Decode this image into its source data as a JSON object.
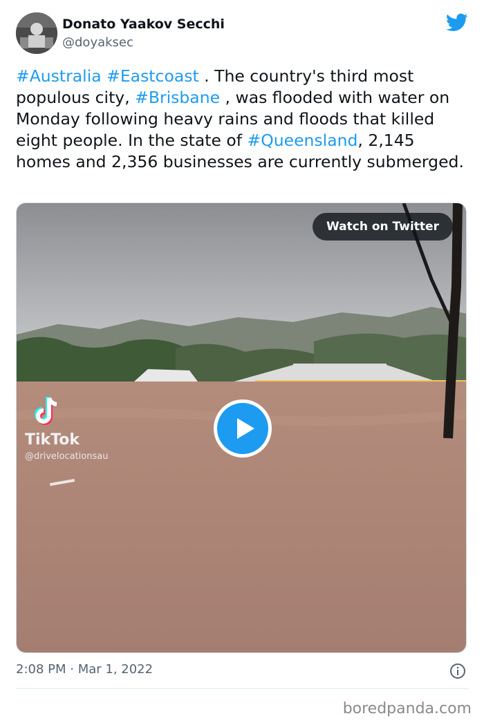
{
  "user": {
    "name": "Donato Yaakov Secchi",
    "handle": "@doyaksec"
  },
  "tweet": {
    "tag_australia": "#Australia",
    "tag_eastcoast": "#Eastcoast",
    "text_1": " .  The country's third most populous city, ",
    "tag_brisbane": "#Brisbane",
    "text_2": " , was flooded with water on Monday following heavy rains and floods that killed eight people.  In the state of ",
    "tag_queensland": "#Queensland",
    "text_3": ", 2,145 homes and 2,356 businesses are currently submerged.",
    "timestamp": "2:08 PM · Mar 1, 2022"
  },
  "media": {
    "watch_label": "Watch on Twitter",
    "tiktok_name": "TikTok",
    "tiktok_handle": "@drivelocationsau"
  },
  "icons": {
    "bird": "twitter-bird-icon",
    "play": "play-icon",
    "info": "info-icon"
  },
  "colors": {
    "accent": "#1d9bf0",
    "text": "#0f1419",
    "muted": "#536471"
  },
  "watermark": "boredpanda.com"
}
